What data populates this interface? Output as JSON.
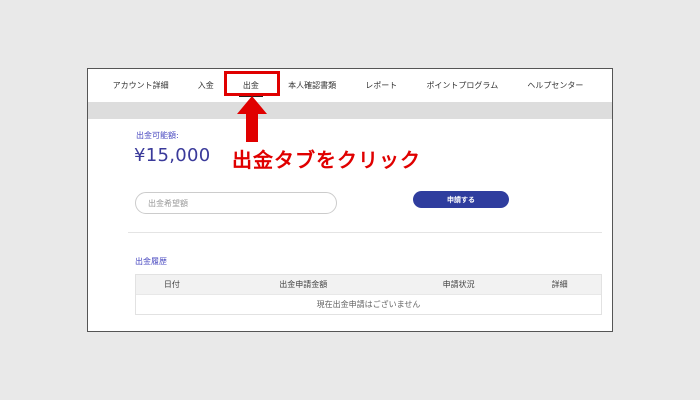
{
  "nav": {
    "tabs": [
      {
        "label": "アカウント詳細"
      },
      {
        "label": "入金"
      },
      {
        "label": "出金"
      },
      {
        "label": "本人確認書類"
      },
      {
        "label": "レポート"
      },
      {
        "label": "ポイントプログラム"
      },
      {
        "label": "ヘルプセンター"
      }
    ],
    "active_tab": "出金"
  },
  "withdraw": {
    "available_label": "出金可能額:",
    "available_amount": "¥15,000",
    "amount_placeholder": "出金希望額",
    "apply_label": "申請する"
  },
  "history": {
    "title": "出金履歴",
    "columns": [
      "日付",
      "出金申請金額",
      "申請状況",
      "詳細"
    ],
    "empty_message": "現在出金申請はございません"
  },
  "annotation": {
    "callout": "出金タブをクリック",
    "color": "#e00000"
  }
}
